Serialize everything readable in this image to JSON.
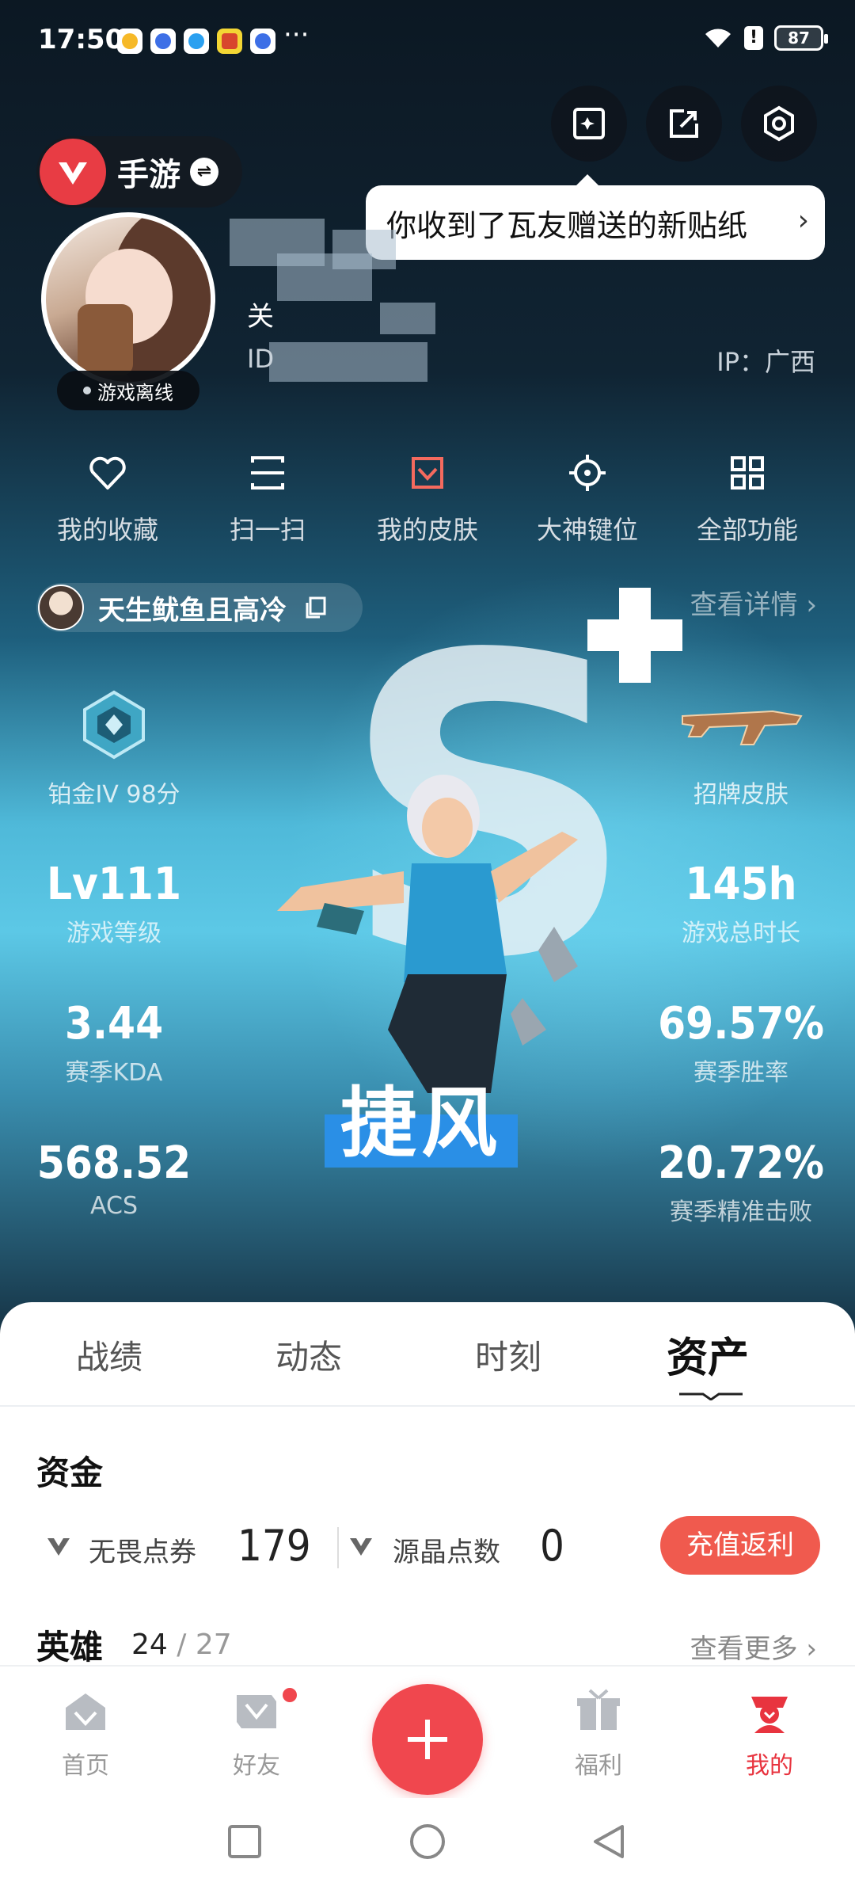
{
  "status_bar": {
    "time": "17:50",
    "more": "···",
    "battery": "87",
    "alert": "!"
  },
  "header": {
    "game_name": "手游",
    "switch_symbol": "⇌",
    "tooltip": "你收到了瓦友赠送的新贴纸",
    "tooltip_chevron": "›"
  },
  "profile": {
    "online_status": "游戏离线",
    "name_prefix": "关",
    "id_prefix": "ID",
    "ip": "IP：广西"
  },
  "quick_actions": [
    {
      "label": "我的收藏",
      "icon": "heart-icon"
    },
    {
      "label": "扫一扫",
      "icon": "scan-icon"
    },
    {
      "label": "我的皮肤",
      "icon": "skin-icon"
    },
    {
      "label": "大神键位",
      "icon": "crosshair-icon"
    },
    {
      "label": "全部功能",
      "icon": "grid-icon"
    }
  ],
  "player": {
    "nickname": "天生鱿鱼且高冷",
    "detail_link": "查看详情 ›"
  },
  "card": {
    "rank_label": "铂金IV 98分",
    "signature_skin_label": "招牌皮肤",
    "agent_name": "捷风",
    "stats_left": [
      {
        "value": "Lv111",
        "label": "游戏等级"
      },
      {
        "value": "3.44",
        "label": "赛季KDA"
      },
      {
        "value": "568.52",
        "label": "ACS"
      }
    ],
    "stats_right": [
      {
        "value": "145h",
        "label": "游戏总时长"
      },
      {
        "value": "69.57%",
        "label": "赛季胜率"
      },
      {
        "value": "20.72%",
        "label": "赛季精准击败"
      }
    ]
  },
  "tabs": {
    "items": [
      "战绩",
      "动态",
      "时刻",
      "资产"
    ],
    "active": "资产"
  },
  "assets": {
    "title": "资金",
    "currency1_label": "无畏点券",
    "currency1_value": "179",
    "currency2_label": "源晶点数",
    "currency2_value": "0",
    "recharge_label": "充值返利"
  },
  "heroes": {
    "title": "英雄",
    "owned": "24",
    "separator": "/",
    "total": "27",
    "see_more": "查看更多 ›"
  },
  "bottom_nav": {
    "items": [
      {
        "label": "首页",
        "icon": "home-icon"
      },
      {
        "label": "好友",
        "icon": "friends-icon"
      },
      {
        "label": "福利",
        "icon": "gift-icon"
      },
      {
        "label": "我的",
        "icon": "profile-icon"
      }
    ],
    "active": "我的",
    "accent_color": "#e8343f"
  },
  "colors": {
    "primary_red": "#f0474e",
    "recharge_button": "#f05a4e",
    "agent_label_bg": "#2a8fe6"
  }
}
